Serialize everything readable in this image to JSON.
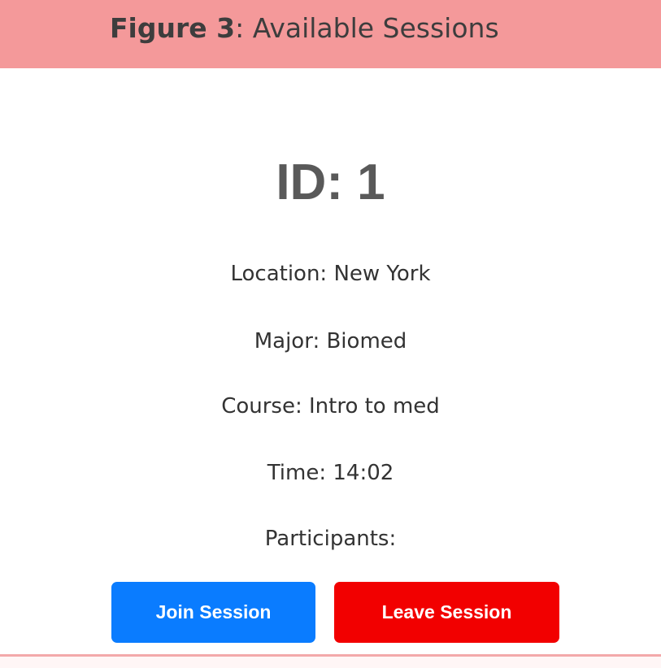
{
  "figure": {
    "label": "Figure 3",
    "separator": ": ",
    "title": "Available Sessions"
  },
  "session": {
    "id_text": "ID: 1",
    "location": "Location: New York",
    "major": "Major: Biomed",
    "course": "Course: Intro to med",
    "time": "Time: 14:02",
    "participants": "Participants:"
  },
  "actions": {
    "join_label": "Join Session",
    "leave_label": "Leave Session"
  },
  "colors": {
    "banner": "#f4999a",
    "join": "#0a7cff",
    "leave": "#f20000"
  }
}
